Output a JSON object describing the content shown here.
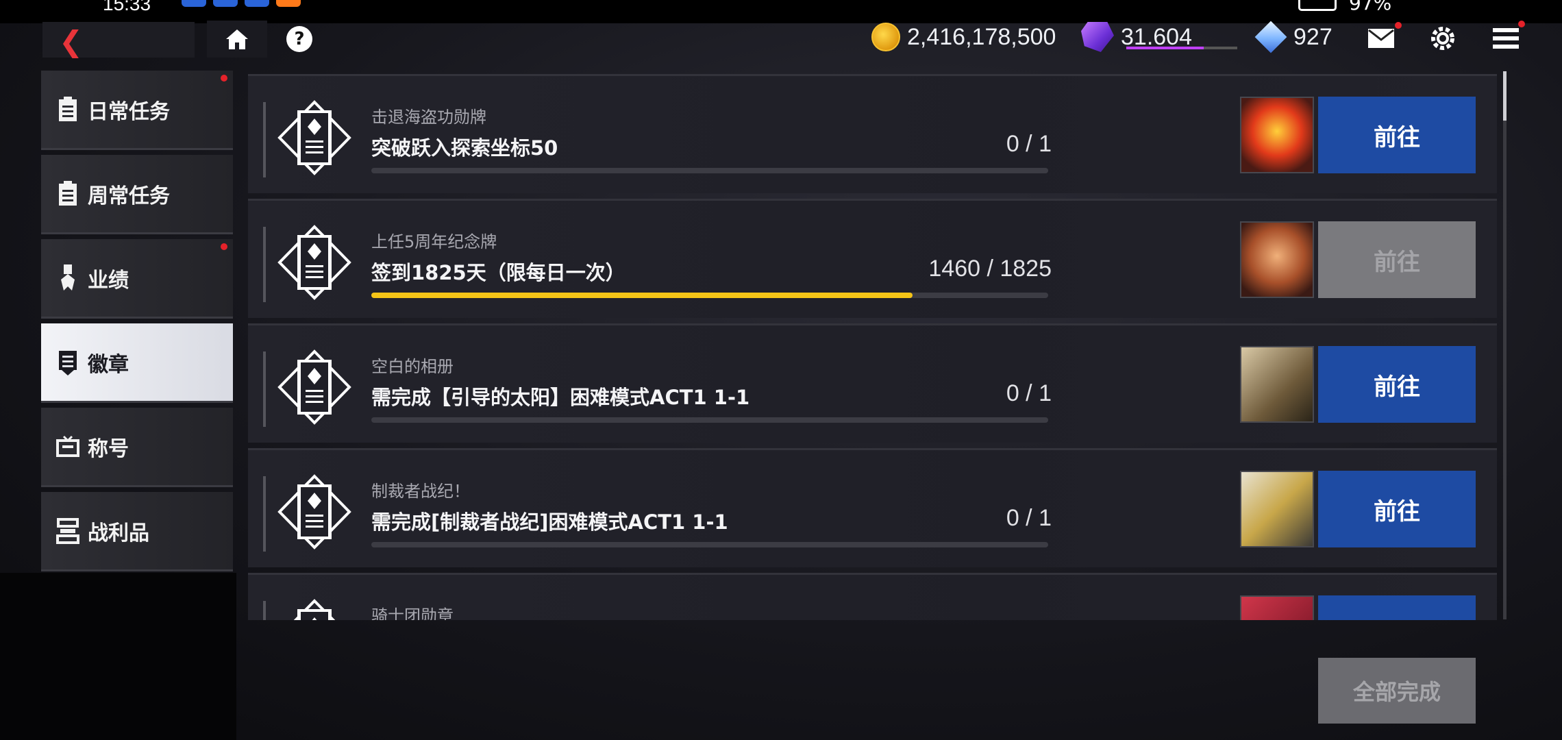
{
  "status": {
    "time": "15:33",
    "battery": "97%"
  },
  "currency": {
    "gold": "2,416,178,500",
    "gem": "31.604",
    "gem_progress": 0.7,
    "diamond": "927"
  },
  "help_label": "?",
  "sidebar": {
    "items": [
      {
        "label": "日常任务",
        "icon": "clipboard-icon",
        "active": false,
        "dot": true
      },
      {
        "label": "周常任务",
        "icon": "clipboard-icon",
        "active": false,
        "dot": false
      },
      {
        "label": "业绩",
        "icon": "medal-icon",
        "active": false,
        "dot": true
      },
      {
        "label": "徽章",
        "icon": "badge-icon",
        "active": true,
        "dot": false
      },
      {
        "label": "称号",
        "icon": "title-icon",
        "active": false,
        "dot": false
      },
      {
        "label": "战利品",
        "icon": "trophy-icon",
        "active": false,
        "dot": false
      }
    ]
  },
  "tasks": [
    {
      "category": "击退海盗功勋牌",
      "title": "突破跃入探索坐标50",
      "progress": "0 / 1",
      "fill": 0,
      "button": "前往",
      "enabled": true,
      "reward": "pirate-medal-icon"
    },
    {
      "category": "上任5周年纪念牌",
      "title": "签到1825天（限每日一次）",
      "progress": "1460 / 1825",
      "fill": 0.8,
      "button": "前往",
      "enabled": false,
      "reward": "anniversary-medal-icon"
    },
    {
      "category": "空白的相册",
      "title": "需完成【引导的太阳】困难模式ACT1 1-1",
      "progress": "0 / 1",
      "fill": 0,
      "button": "前往",
      "enabled": true,
      "reward": "album-icon"
    },
    {
      "category": "制裁者战纪！",
      "title": "需完成[制裁者战纪]困难模式ACT1 1-1",
      "progress": "0 / 1",
      "fill": 0,
      "button": "前往",
      "enabled": true,
      "reward": "record-icon"
    },
    {
      "category": "骑士团勋章",
      "title": "",
      "progress": "",
      "fill": 0,
      "button": "",
      "enabled": true,
      "reward": "knight-medal-icon"
    }
  ],
  "footer": {
    "complete_all": "全部完成"
  },
  "colors": {
    "accent_blue": "#1e4ba3",
    "progress_yellow": "#f4c417",
    "alert_red": "#e5222a",
    "back_red": "#e8343a"
  }
}
